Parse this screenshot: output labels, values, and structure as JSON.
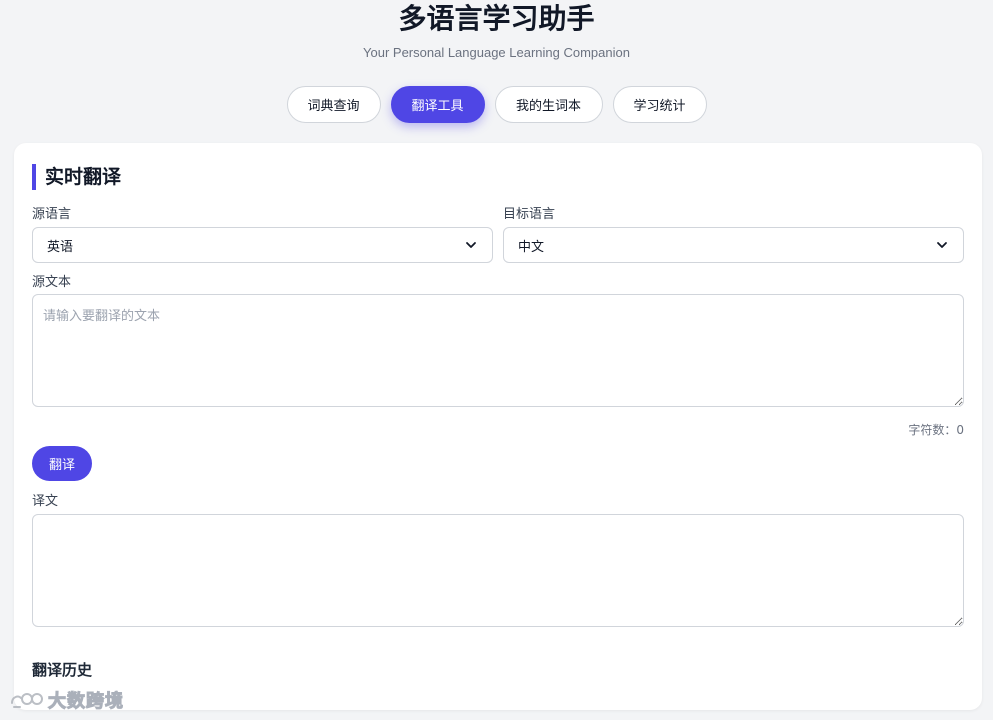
{
  "header": {
    "title": "多语言学习助手",
    "subtitle": "Your Personal Language Learning Companion"
  },
  "tabs": [
    {
      "label": "词典查询",
      "active": false
    },
    {
      "label": "翻译工具",
      "active": true
    },
    {
      "label": "我的生词本",
      "active": false
    },
    {
      "label": "学习统计",
      "active": false
    }
  ],
  "translate": {
    "section_title": "实时翻译",
    "source_lang_label": "源语言",
    "source_lang_value": "英语",
    "target_lang_label": "目标语言",
    "target_lang_value": "中文",
    "source_text_label": "源文本",
    "source_text_placeholder": "请输入要翻译的文本",
    "source_text_value": "",
    "char_count": "字符数：0",
    "translate_button": "翻译",
    "result_label": "译文",
    "result_value": "",
    "history_title": "翻译历史"
  },
  "watermark": {
    "text": "大数跨境"
  },
  "colors": {
    "accent": "#4f46e5",
    "background": "#f3f4f6",
    "card": "#ffffff"
  }
}
